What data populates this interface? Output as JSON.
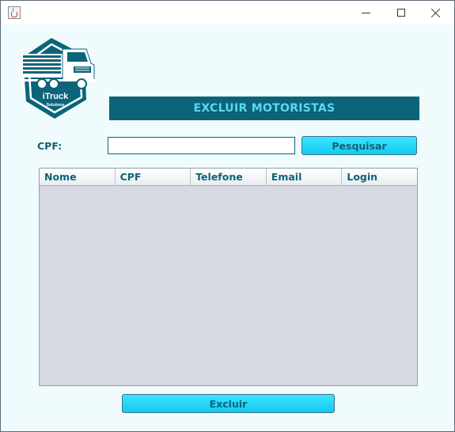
{
  "window": {
    "controls": {
      "minimize": "minimize-icon",
      "maximize": "maximize-icon",
      "close": "close-icon"
    },
    "app_icon": "java-cup-icon"
  },
  "logo": {
    "brand": "iTruck",
    "tagline": "Solutions",
    "icon": "truck-logo"
  },
  "header": {
    "title": "EXCLUIR MOTORISTAS"
  },
  "search": {
    "label": "CPF:",
    "value": "",
    "placeholder": "",
    "button_label": "Pesquisar"
  },
  "table": {
    "columns": [
      "Nome",
      "CPF",
      "Telefone",
      "Email",
      "Login"
    ],
    "rows": []
  },
  "actions": {
    "delete_label": "Excluir"
  },
  "colors": {
    "primary": "#0b6479",
    "accent": "#5ad8f0",
    "button": "#12cbef",
    "background": "#f0fbfd",
    "table_bg": "#d6d9e2"
  }
}
